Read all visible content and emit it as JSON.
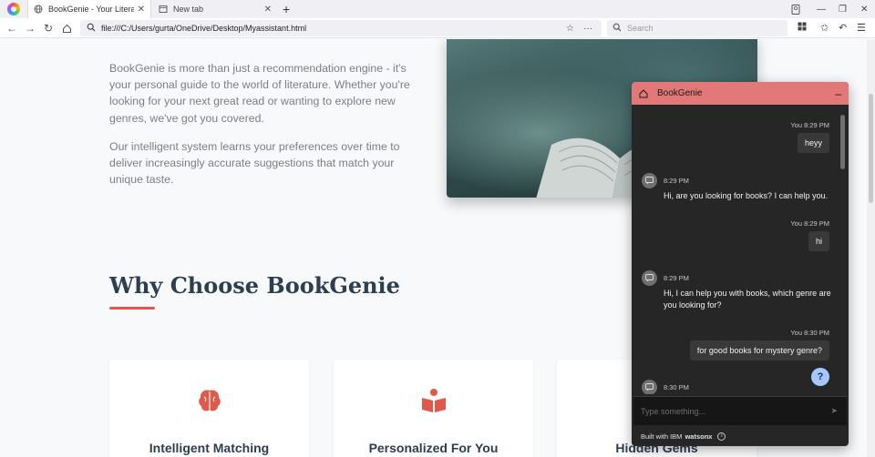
{
  "browser": {
    "tabs": [
      {
        "title": "BookGenie - Your Literary Co",
        "active": true
      },
      {
        "title": "New tab",
        "active": false
      }
    ],
    "url": "file:///C:/Users/gurta/OneDrive/Desktop/Myassistant.html",
    "search_placeholder": "Search"
  },
  "page": {
    "intro_p1": "BookGenie is more than just a recommendation engine - it's your personal guide to the world of literature. Whether you're looking for your next great read or wanting to explore new genres, we've got you covered.",
    "intro_p2": "Our intelligent system learns your preferences over time to deliver increasingly accurate suggestions that match your unique taste.",
    "section_title": "Why Choose BookGenie",
    "accent_color": "#e05a4c",
    "cards": [
      {
        "title": "Intelligent Matching",
        "icon": "brain-icon"
      },
      {
        "title": "Personalized For You",
        "icon": "reading-person-icon"
      },
      {
        "title": "Hidden Gems",
        "icon": "gem-icon"
      }
    ]
  },
  "chat": {
    "title": "BookGenie",
    "header_color": "#e27878",
    "messages": [
      {
        "from": "user",
        "meta": "You 8:29 PM",
        "text": "heyy"
      },
      {
        "from": "bot",
        "meta": "8:29 PM",
        "text": "Hi, are you looking for books? I can help you."
      },
      {
        "from": "user",
        "meta": "You 8:29 PM",
        "text": "hi"
      },
      {
        "from": "bot",
        "meta": "8:29 PM",
        "text": "Hi, I can help you with books, which genre are you looking for?"
      },
      {
        "from": "user",
        "meta": "You 8:30 PM",
        "text": "for good books for mystery genre?"
      },
      {
        "from": "bot",
        "meta": "8:30 PM",
        "text": ""
      }
    ],
    "input_placeholder": "Type something...",
    "footer_prefix": "Built with IBM",
    "footer_brand": "watsonx",
    "help_label": "?"
  }
}
